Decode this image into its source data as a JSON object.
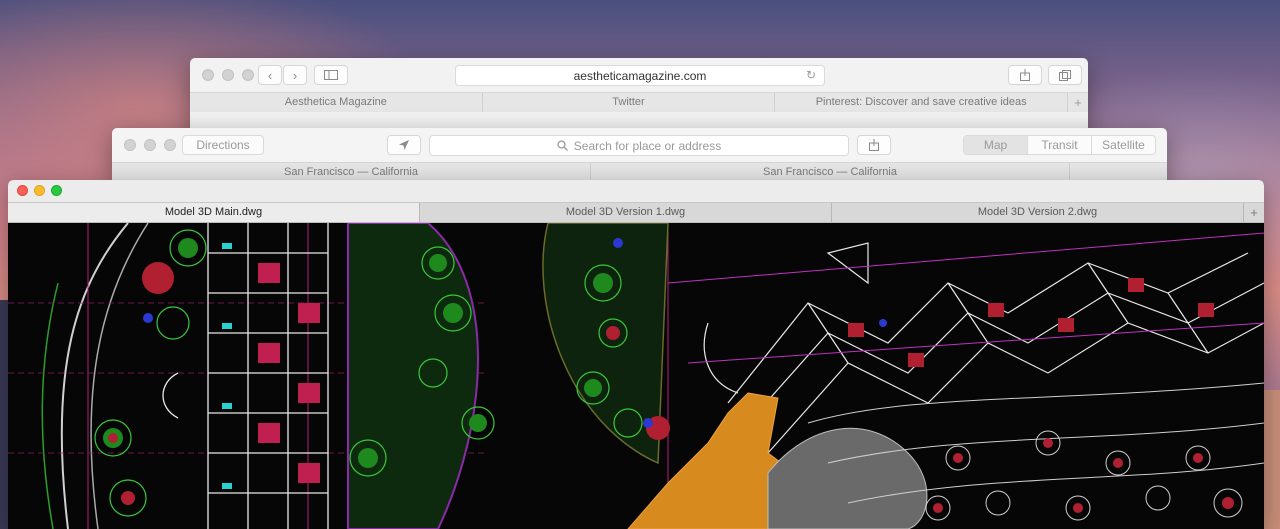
{
  "safari": {
    "url": "aestheticamagazine.com",
    "tabs": [
      "Aesthetica Magazine",
      "Twitter",
      "Pinterest: Discover and save creative ideas"
    ],
    "add_tab": "+"
  },
  "maps": {
    "directions_label": "Directions",
    "search_placeholder": "Search for place or address",
    "modes": [
      "Map",
      "Transit",
      "Satellite"
    ],
    "tabs": [
      "San Francisco — California",
      "San Francisco — California"
    ]
  },
  "cad": {
    "tabs": [
      "Model 3D Main.dwg",
      "Model 3D Version 1.dwg",
      "Model 3D Version 2.dwg"
    ],
    "active_tab": "Model 3D Main.dwg",
    "add_tab": "+"
  },
  "icons": {
    "back": "chevron-left-icon",
    "forward": "chevron-right-icon",
    "sidebar": "sidebar-icon",
    "reload": "reload-icon",
    "share": "share-icon",
    "tabs_overview": "tabs-icon",
    "location": "location-arrow-icon",
    "search": "search-icon"
  }
}
